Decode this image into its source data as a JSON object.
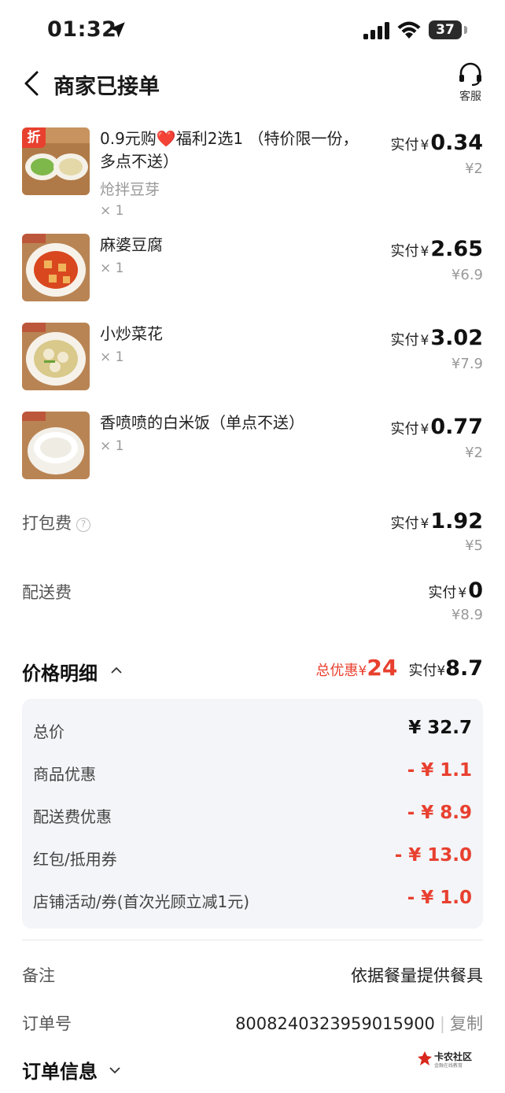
{
  "status_bar": {
    "time": "01:32",
    "battery": "37"
  },
  "nav": {
    "title": "商家已接单",
    "service_label": "客服"
  },
  "items": [
    {
      "name": "0.9元购❤️福利2选1 （特价限一份，多点不送）",
      "sub": "炝拌豆芽",
      "qty": "× 1",
      "pay_label": "实付",
      "yen": "¥",
      "amount": "0.34",
      "original": "¥2",
      "tag": "折"
    },
    {
      "name": "麻婆豆腐",
      "qty": "× 1",
      "pay_label": "实付",
      "yen": "¥",
      "amount": "2.65",
      "original": "¥6.9"
    },
    {
      "name": "小炒菜花",
      "qty": "× 1",
      "pay_label": "实付",
      "yen": "¥",
      "amount": "3.02",
      "original": "¥7.9"
    },
    {
      "name": "香喷喷的白米饭（单点不送）",
      "qty": "× 1",
      "pay_label": "实付",
      "yen": "¥",
      "amount": "0.77",
      "original": "¥2"
    }
  ],
  "fees": {
    "packing": {
      "label": "打包费",
      "help": "?",
      "pay_label": "实付",
      "yen": "¥",
      "amount": "1.92",
      "original": "¥5"
    },
    "delivery": {
      "label": "配送费",
      "pay_label": "实付",
      "yen": "¥",
      "amount": "0",
      "original": "¥8.9"
    }
  },
  "price_detail": {
    "title": "价格明细",
    "discount_label": "总优惠",
    "yen": "¥",
    "discount_amount": "24",
    "paid_label": "实付",
    "paid_amount": "8.7",
    "rows": [
      {
        "label": "总价",
        "value": "¥ 32.7"
      },
      {
        "label": "商品优惠",
        "value": "- ¥ 1.1"
      },
      {
        "label": "配送费优惠",
        "value": "- ¥ 8.9"
      },
      {
        "label": "红包/抵用券",
        "value": "- ¥ 13.0"
      },
      {
        "label": "店铺活动/券(首次光顾立减1元)",
        "value": "- ¥ 1.0"
      }
    ]
  },
  "remark": {
    "label": "备注",
    "value": "依据餐量提供餐具"
  },
  "order_no": {
    "label": "订单号",
    "value": "8008240323959015900",
    "sep": "|",
    "copy": "复制"
  },
  "order_info": {
    "title": "订单信息"
  },
  "watermark": {
    "text": "卡农社区",
    "sub": "金融在线教育"
  },
  "colors": {
    "accent_red": "#e8402f",
    "text": "#1a1a1a",
    "muted": "#999999",
    "panel": "#f3f5f8"
  }
}
